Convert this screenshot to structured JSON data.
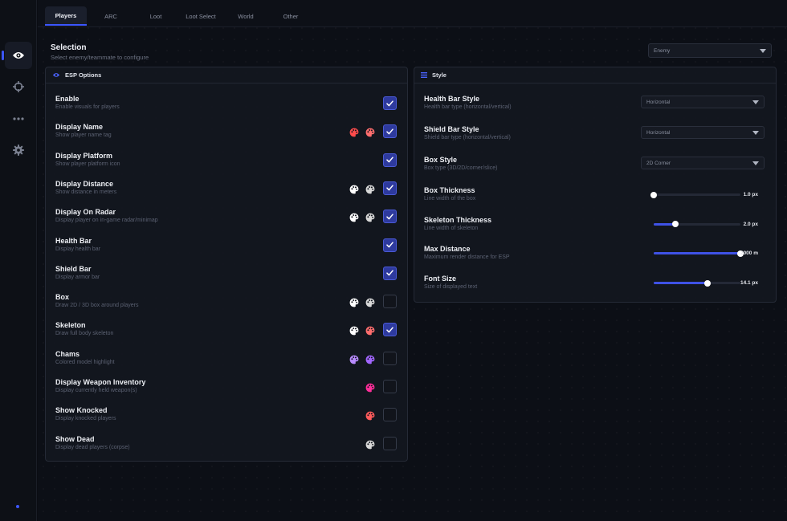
{
  "colors": {
    "accent": "#3c56ff",
    "checkbox_on": "#2e3a9e"
  },
  "tabs": [
    {
      "label": "Players",
      "active": true
    },
    {
      "label": "ARC",
      "active": false
    },
    {
      "label": "Loot",
      "active": false
    },
    {
      "label": "Loot Select",
      "active": false
    },
    {
      "label": "World",
      "active": false
    },
    {
      "label": "Other",
      "active": false
    }
  ],
  "sidebar": {
    "items": [
      {
        "icon": "eye-icon",
        "active": true
      },
      {
        "icon": "crosshair-icon",
        "active": false
      },
      {
        "icon": "more-icon",
        "active": false
      },
      {
        "icon": "gear-icon",
        "active": false
      }
    ]
  },
  "selection": {
    "title": "Selection",
    "subtitle": "Select enemy/teammate to configure",
    "value": "Enemy"
  },
  "esp": {
    "title": "ESP Options",
    "rows": [
      {
        "label": "Enable",
        "desc": "Enable visuals for players",
        "checked": true,
        "palettes": []
      },
      {
        "label": "Display Name",
        "desc": "Show player name tag",
        "checked": true,
        "palettes": [
          "#ff4c4c",
          "#ff6e6e"
        ]
      },
      {
        "label": "Display Platform",
        "desc": "Show player platform icon",
        "checked": true,
        "palettes": []
      },
      {
        "label": "Display Distance",
        "desc": "Show distance in meters",
        "checked": true,
        "palettes": [
          "#ffffff",
          "#d8d8d8"
        ]
      },
      {
        "label": "Display On Radar",
        "desc": "Display player on in-game radar/minimap",
        "checked": true,
        "palettes": [
          "#ffffff",
          "#d8d8d8"
        ]
      },
      {
        "label": "Health Bar",
        "desc": "Display health bar",
        "checked": true,
        "palettes": []
      },
      {
        "label": "Shield Bar",
        "desc": "Display armor bar",
        "checked": true,
        "palettes": []
      },
      {
        "label": "Box",
        "desc": "Draw 2D / 3D box around players",
        "checked": false,
        "palettes": [
          "#ffffff",
          "#d8d8d8"
        ]
      },
      {
        "label": "Skeleton",
        "desc": "Draw full body skeleton",
        "checked": true,
        "palettes": [
          "#ffffff",
          "#ff6e6e"
        ]
      },
      {
        "label": "Chams",
        "desc": "Colored model highlight",
        "checked": false,
        "palettes": [
          "#b98cff",
          "#a266ff"
        ]
      },
      {
        "label": "Display Weapon Inventory",
        "desc": "Display currently held weapon(s)",
        "checked": false,
        "palettes": [
          "#ff2e9a"
        ]
      },
      {
        "label": "Show Knocked",
        "desc": "Display knocked players",
        "checked": false,
        "palettes": [
          "#ff5b5b"
        ]
      },
      {
        "label": "Show Dead",
        "desc": "Display dead players (corpse)",
        "checked": false,
        "palettes": [
          "#d8d8d8"
        ]
      }
    ]
  },
  "style": {
    "title": "Style",
    "dropdowns": [
      {
        "label": "Health Bar Style",
        "desc": "Health bar type (horizontal/vertical)",
        "value": "Horizontal"
      },
      {
        "label": "Shield Bar Style",
        "desc": "Shield bar type (horizontal/vertical)",
        "value": "Horizontal"
      },
      {
        "label": "Box Style",
        "desc": "Box type (3D/2D/corner/slice)",
        "value": "2D Corner"
      }
    ],
    "sliders": [
      {
        "label": "Box Thickness",
        "desc": "Line width of the box",
        "value": "1.0 px",
        "fraction": 0.0
      },
      {
        "label": "Skeleton Thickness",
        "desc": "Line width of skeleton",
        "value": "2.0 px",
        "fraction": 0.25
      },
      {
        "label": "Max Distance",
        "desc": "Maximum render distance for ESP",
        "value": "2000 m",
        "fraction": 1.0
      },
      {
        "label": "Font Size",
        "desc": "Size of displayed text",
        "value": "14.1 px",
        "fraction": 0.62
      }
    ]
  }
}
